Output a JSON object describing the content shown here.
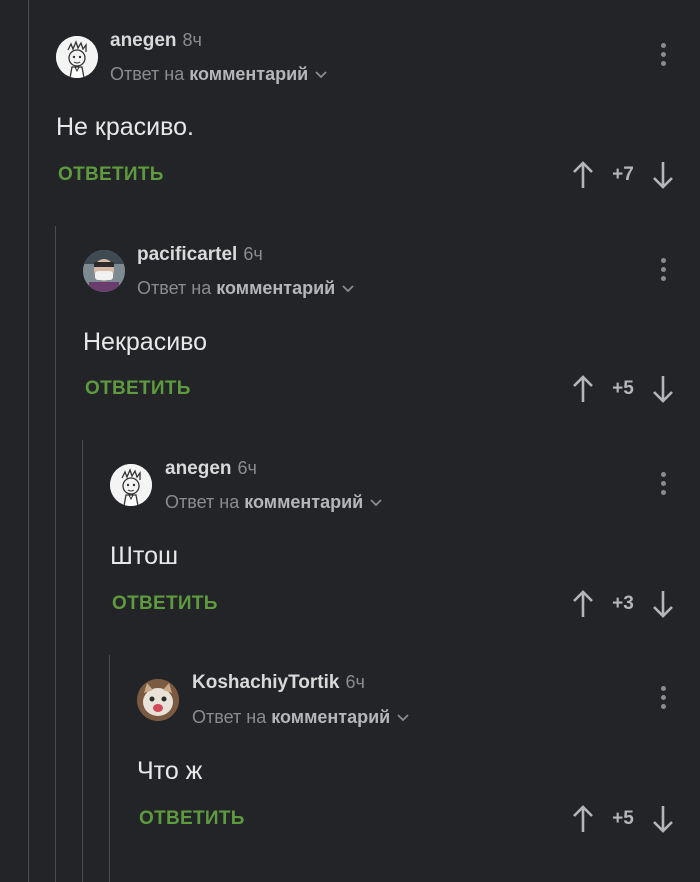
{
  "comments": [
    {
      "author": "anegen",
      "time": "8ч",
      "reply_prefix": "Ответ на",
      "reply_target": "комментарий",
      "text": "Не красиво.",
      "reply_label": "ОТВЕТИТЬ",
      "score": "+7"
    },
    {
      "author": "pacificartel",
      "time": "6ч",
      "reply_prefix": "Ответ на",
      "reply_target": "комментарий",
      "text": "Некрасиво",
      "reply_label": "ОТВЕТИТЬ",
      "score": "+5"
    },
    {
      "author": "anegen",
      "time": "6ч",
      "reply_prefix": "Ответ на",
      "reply_target": "комментарий",
      "text": "Штош",
      "reply_label": "ОТВЕТИТЬ",
      "score": "+3"
    },
    {
      "author": "KoshachiyTortik",
      "time": "6ч",
      "reply_prefix": "Ответ на",
      "reply_target": "комментарий",
      "text": "Что ж",
      "reply_label": "ОТВЕТИТЬ",
      "score": "+5"
    }
  ],
  "colors": {
    "background": "#222428",
    "reply_green": "#5e9a3e",
    "thread_line": "#4a4d52"
  }
}
